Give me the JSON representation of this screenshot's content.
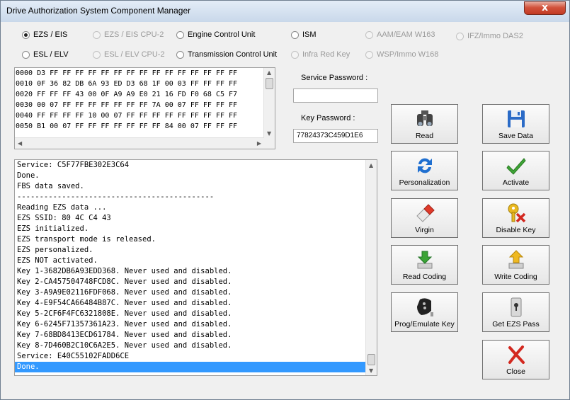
{
  "window": {
    "title": "Drive Authorization System Component Manager",
    "close_glyph": "x"
  },
  "modes": {
    "row1": [
      {
        "label": "EZS / EIS",
        "checked": true,
        "enabled": true
      },
      {
        "label": "EZS / EIS CPU-2",
        "checked": false,
        "enabled": false
      },
      {
        "label": "Engine Control Unit",
        "checked": false,
        "enabled": true
      },
      {
        "label": "ISM",
        "checked": false,
        "enabled": true
      },
      {
        "label": "AAM/EAM W163",
        "checked": false,
        "enabled": false
      },
      {
        "label": "IFZ/Immo DAS2",
        "checked": false,
        "enabled": false
      }
    ],
    "row2": [
      {
        "label": "ESL / ELV",
        "checked": false,
        "enabled": true
      },
      {
        "label": "ESL / ELV CPU-2",
        "checked": false,
        "enabled": false
      },
      {
        "label": "Transmission Control Unit",
        "checked": false,
        "enabled": true
      },
      {
        "label": "Infra Red Key",
        "checked": false,
        "enabled": false
      },
      {
        "label": "WSP/Immo W168",
        "checked": false,
        "enabled": false
      }
    ]
  },
  "hex_dump": [
    "0000 D3 FF FF FF FF FF FF FF FF FF FF FF FF FF FF FF",
    "0010 0F 36 82 DB 6A 93 ED D3 68 1F 00 03 FF FF FF FF",
    "0020 FF FF FF 43 00 0F A9 A9 E0 21 16 FD F0 68 C5 F7",
    "0030 00 07 FF FF FF FF FF FF FF 7A 00 07 FF FF FF FF",
    "0040 FF FF FF FF 10 00 07 FF FF FF FF FF FF FF FF FF",
    "0050 B1 00 07 FF FF FF FF FF FF FF 84 00 07 FF FF FF"
  ],
  "passwords": {
    "service_label": "Service Password :",
    "service_value": "",
    "key_label": "Key Password :",
    "key_value": "77824373C459D1E6"
  },
  "log": [
    "Service: C5F77FBE302E3C64",
    "Done.",
    "FBS data saved.",
    "--------------------------------------------",
    "Reading EZS data ...",
    "EZS SSID: 80 4C C4 43",
    "EZS initialized.",
    "EZS transport mode is released.",
    "EZS personalized.",
    "EZS NOT activated.",
    "Key 1-3682DB6A93EDD368. Never used and disabled.",
    "Key 2-CA457504748FCD8C. Never used and disabled.",
    "Key 3-A9A9E02116FDF068. Never used and disabled.",
    "Key 4-E9F54CA66484B87C. Never used and disabled.",
    "Key 5-2CF6F4FC6321808E. Never used and disabled.",
    "Key 6-6245F71357361A23. Never used and disabled.",
    "Key 7-68BD8413ECD61784. Never used and disabled.",
    "Key 8-7D460B2C10C6A2E5. Never used and disabled.",
    "Service: E40C55102FADD6CE",
    "Done."
  ],
  "log_selected_index": 19,
  "buttons": {
    "read": {
      "label": "Read",
      "icon": "binoculars-icon"
    },
    "save_data": {
      "label": "Save Data",
      "icon": "floppy-disk-icon"
    },
    "personalization": {
      "label": "Personalization",
      "icon": "sync-arrows-icon"
    },
    "activate": {
      "label": "Activate",
      "icon": "checkmark-icon"
    },
    "virgin": {
      "label": "Virgin",
      "icon": "eraser-icon"
    },
    "disable_key": {
      "label": "Disable Key",
      "icon": "key-disable-icon"
    },
    "read_coding": {
      "label": "Read Coding",
      "icon": "download-arrow-icon"
    },
    "write_coding": {
      "label": "Write Coding",
      "icon": "upload-arrow-icon"
    },
    "prog_emulate_key": {
      "label": "Prog/Emulate Key",
      "icon": "car-key-fob-icon"
    },
    "get_ezs_pass": {
      "label": "Get EZS Pass",
      "icon": "ezs-lock-icon"
    },
    "close": {
      "label": "Close",
      "icon": "close-x-icon"
    }
  },
  "colors": {
    "selection": "#3399ff",
    "accent_red": "#d2523c"
  }
}
